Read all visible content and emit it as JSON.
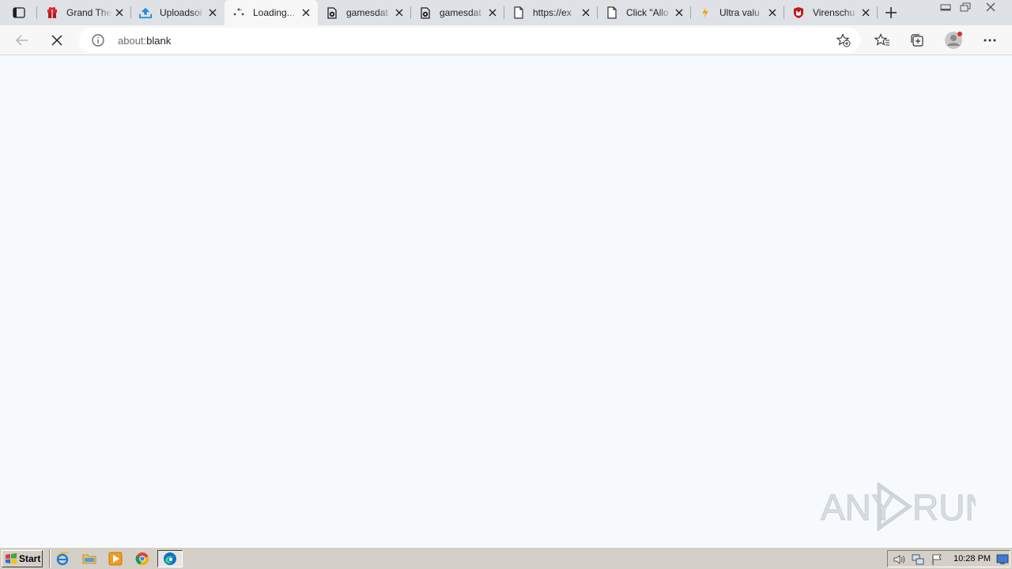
{
  "browser": {
    "tabs": [
      {
        "title": "Grand The",
        "icon": "red-gift-icon",
        "active": false
      },
      {
        "title": "Uploadsoi",
        "icon": "upload-arrow-icon",
        "active": false
      },
      {
        "title": "Loading...",
        "icon": "loading-spinner-icon",
        "active": true
      },
      {
        "title": "gamesdat",
        "icon": "gamesdatabase-icon",
        "active": false
      },
      {
        "title": "gamesdat",
        "icon": "gamesdatabase-icon",
        "active": false
      },
      {
        "title": "https://ex",
        "icon": "page-icon",
        "active": false
      },
      {
        "title": "Click \"Allo",
        "icon": "page-icon",
        "active": false
      },
      {
        "title": "Ultra valu",
        "icon": "lightning-icon",
        "active": false
      },
      {
        "title": "Virenschu",
        "icon": "mcafee-shield-icon",
        "active": false
      }
    ],
    "address": {
      "scheme": "about:",
      "path": "blank"
    },
    "colors": {
      "tabstrip": "#dee1e6",
      "toolbar": "#f7f7f7",
      "page_background": "#f7fafc",
      "accent_blue": "#0078d4",
      "mcafee_red": "#c01818"
    }
  },
  "watermark": {
    "text_left": "ANY",
    "text_right": "RUN"
  },
  "taskbar": {
    "start_label": "Start",
    "clock": "10:28 PM",
    "quick_launch": [
      "internet-explorer-icon",
      "folder-icon",
      "media-player-icon",
      "chrome-icon"
    ],
    "active_task": "edge-icon"
  }
}
